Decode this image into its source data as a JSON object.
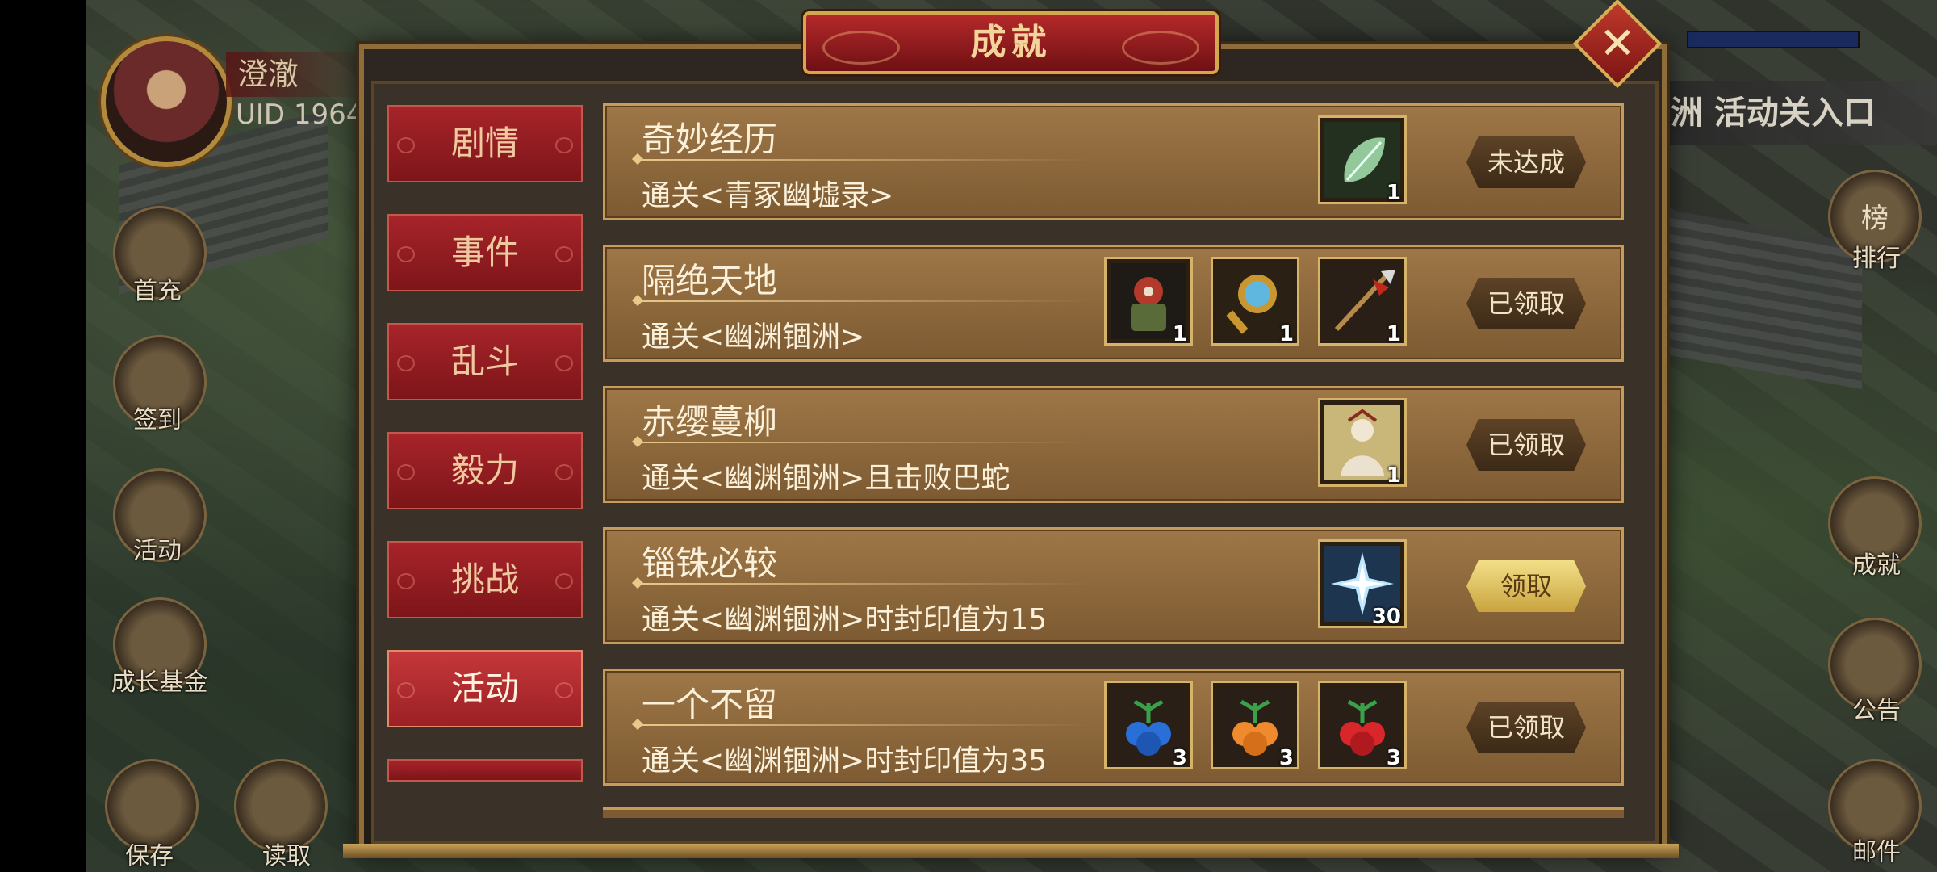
{
  "hud": {
    "player_name": "澄澈",
    "uid": "UID  1964",
    "left_buttons": [
      "首充",
      "签到",
      "活动",
      "成长基金"
    ],
    "bottom_buttons": [
      "保存",
      "读取"
    ],
    "right_banner": "洲 活动关入口",
    "right_buttons": [
      "排行",
      "成就",
      "公告",
      "邮件"
    ],
    "rank_glyph": "榜"
  },
  "dialog": {
    "title": "成就",
    "close_symbol": "✕"
  },
  "tabs": [
    {
      "label": "剧情",
      "active": false
    },
    {
      "label": "事件",
      "active": false
    },
    {
      "label": "乱斗",
      "active": false
    },
    {
      "label": "毅力",
      "active": false
    },
    {
      "label": "挑战",
      "active": false
    },
    {
      "label": "活动",
      "active": true
    }
  ],
  "achievements": [
    {
      "title": "奇妙经历",
      "description": "通关<青冢幽墟录>",
      "rewards": [
        {
          "icon": "leaf-icon",
          "count": "1"
        }
      ],
      "status": "未达成"
    },
    {
      "title": "隔绝天地",
      "description": "通关<幽渊锢洲>",
      "rewards": [
        {
          "icon": "armor-icon",
          "count": "1"
        },
        {
          "icon": "mirror-icon",
          "count": "1"
        },
        {
          "icon": "spear-icon",
          "count": "1"
        }
      ],
      "status": "已领取"
    },
    {
      "title": "赤缨蔓柳",
      "description": "通关<幽渊锢洲>且击败巴蛇",
      "rewards": [
        {
          "icon": "character-card-icon",
          "count": "1"
        }
      ],
      "status": "已领取"
    },
    {
      "title": "锱铢必较",
      "description": "通关<幽渊锢洲>时封印值为15",
      "rewards": [
        {
          "icon": "ice-crystal-icon",
          "count": "30"
        }
      ],
      "status": "领取"
    },
    {
      "title": "一个不留",
      "description": "通关<幽渊锢洲>时封印值为35",
      "rewards": [
        {
          "icon": "blue-fruit-icon",
          "count": "3"
        },
        {
          "icon": "orange-fruit-icon",
          "count": "3"
        },
        {
          "icon": "red-fruit-icon",
          "count": "3"
        }
      ],
      "status": "已领取"
    }
  ],
  "colors": {
    "title_plate": "#b5292a",
    "tab_active": "#c4373a",
    "row_bg": "#9e7747",
    "claim_button": "#e8c86a"
  }
}
